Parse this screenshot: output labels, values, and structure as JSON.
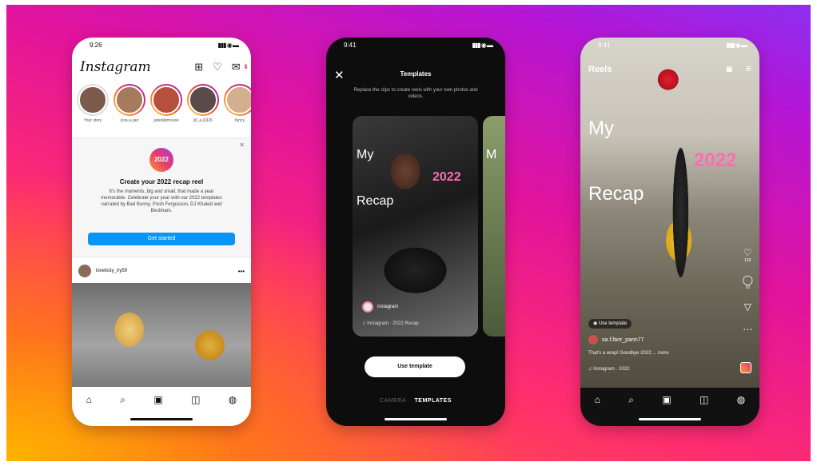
{
  "phone1": {
    "status": {
      "time": "9:26",
      "signal": "▮▮▮ ◉ ▬"
    },
    "app_title": "Instagram",
    "header_icons": [
      "plus-square-icon",
      "heart-icon",
      "messenger-icon"
    ],
    "messenger_badge": "2",
    "stories": [
      {
        "name": "Your story",
        "color": "#7d5b4c"
      },
      {
        "name": "yiza.a.yad",
        "color": "#a67a5d"
      },
      {
        "name": "jadedatmouse",
        "color": "#b5503d"
      },
      {
        "name": "jill_a.j1926",
        "color": "#5a4b4a"
      },
      {
        "name": "fancy",
        "color": "#d2b08e"
      }
    ],
    "recap_card": {
      "badge": "2022",
      "title": "Create your 2022 recap reel",
      "body": "It's the moments, big and small, that made a year memorable. Celebrate your year with our 2022 templates narrated by Bad Bunny, Pooh Fergusson, DJ Khaled and Beckham.",
      "button": "Get started"
    },
    "post": {
      "username": "lovelicky_lry59",
      "more": "•••"
    },
    "tabs": [
      "⌂",
      "⌕",
      "▣",
      "◫",
      "◍"
    ]
  },
  "phone2": {
    "status": {
      "time": "9:41",
      "signal": "▮▮▮ ◉ ▬"
    },
    "close": "✕",
    "title": "Templates",
    "subtitle": "Replace the clips to create reels with your own photos and videos.",
    "card": {
      "line1": "My",
      "line2": "2022",
      "line3": "Recap",
      "user": "instagram",
      "audio": "♫ Instagram · 2022 Recap"
    },
    "card2_text": "M",
    "use_button": "Use template",
    "modes": {
      "camera": "CAMERA",
      "templates": "TEMPLATES"
    }
  },
  "phone3": {
    "status": {
      "time": "9:41",
      "signal": "▮▮▮ ◉ ▬"
    },
    "title": "Reels",
    "overlay": {
      "line1": "My",
      "line2": "2022",
      "line3": "Recap"
    },
    "side_actions": [
      {
        "icon": "♡",
        "count": "120"
      },
      {
        "icon": "◯",
        "count": "10"
      },
      {
        "icon": "▽",
        "count": ""
      },
      {
        "icon": "⋯",
        "count": ""
      }
    ],
    "template_chip": "◉ Use template",
    "username": "sa.f.fanr_pann77",
    "caption": "That's a wrap! Goodbye 2022 ... more",
    "audio": "♫ Instagram · 2022",
    "tabs": [
      "⌂",
      "⌕",
      "▣",
      "◫",
      "◍"
    ]
  }
}
